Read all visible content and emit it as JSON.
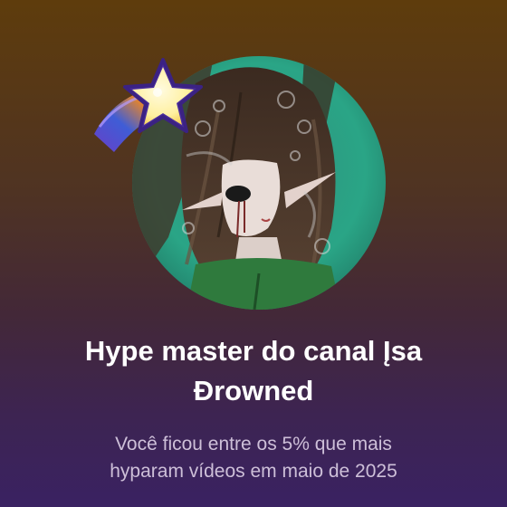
{
  "card": {
    "title_line_1": "Hype master do canal Įsa",
    "title_line_2": "Đrowned",
    "subtitle_line_1": "Você ficou entre os 5% que mais",
    "subtitle_line_2": "hyparam vídeos em maio de 2025"
  },
  "icons": {
    "badge": "shooting-star-icon",
    "avatar": "channel-avatar"
  },
  "colors": {
    "background_top": "#5e3c0c",
    "background_bottom": "#3a2262",
    "title": "#ffffff",
    "subtitle": "#cdbfd8",
    "star": "#fff2a8",
    "star_trail_orange": "#f08a2a",
    "star_trail_purple": "#6a3fd0"
  }
}
